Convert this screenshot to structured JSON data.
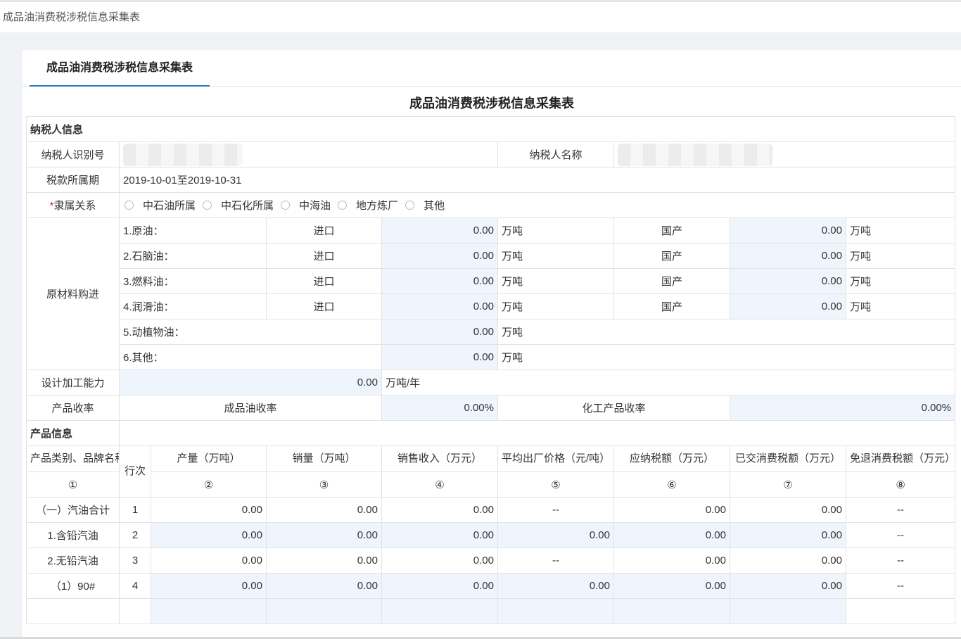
{
  "header": {
    "title": "成品油消费税涉税信息采集表"
  },
  "tab": {
    "label": "成品油消费税涉税信息采集表"
  },
  "form": {
    "title": "成品油消费税涉税信息采集表",
    "taxpayer_section": "纳税人信息",
    "taxpayer_id_label": "纳税人识别号",
    "taxpayer_name_label": "纳税人名称",
    "period_label": "税款所属期",
    "period_value": "2019-10-01至2019-10-31",
    "affiliation_required_mark": "*",
    "affiliation_label": "隶属关系",
    "affiliation_options": [
      "中石油所属",
      "中石化所属",
      "中海油",
      "地方炼厂",
      "其他"
    ],
    "raw_label": "原材料购进",
    "raw_rows": [
      {
        "name": "1.原油：",
        "import_label": "进口",
        "import_value": "0.00",
        "unit": "万吨",
        "domestic_label": "国产",
        "domestic_value": "0.00",
        "domestic_unit": "万吨"
      },
      {
        "name": "2.石脑油：",
        "import_label": "进口",
        "import_value": "0.00",
        "unit": "万吨",
        "domestic_label": "国产",
        "domestic_value": "0.00",
        "domestic_unit": "万吨"
      },
      {
        "name": "3.燃料油：",
        "import_label": "进口",
        "import_value": "0.00",
        "unit": "万吨",
        "domestic_label": "国产",
        "domestic_value": "0.00",
        "domestic_unit": "万吨"
      },
      {
        "name": "4.润滑油：",
        "import_label": "进口",
        "import_value": "0.00",
        "unit": "万吨",
        "domestic_label": "国产",
        "domestic_value": "0.00",
        "domestic_unit": "万吨"
      }
    ],
    "raw_extra": [
      {
        "name": "5.动植物油：",
        "value": "0.00",
        "unit": "万吨"
      },
      {
        "name": "6.其他：",
        "value": "0.00",
        "unit": "万吨"
      }
    ],
    "capacity_label": "设计加工能力",
    "capacity_value": "0.00",
    "capacity_unit": "万吨/年",
    "yield_label": "产品收率",
    "refined_yield_label": "成品油收率",
    "refined_yield_value": "0.00%",
    "chemical_yield_label": "化工产品收率",
    "chemical_yield_value": "0.00%",
    "product_section": "产品信息",
    "product_headers": {
      "category": "产品类别、品牌名称",
      "row_no": "行次",
      "output": "产量（万吨）",
      "sales": "销量（万吨）",
      "revenue": "销售收入（万元）",
      "avg_price": "平均出厂价格（元/吨）",
      "tax_payable": "应纳税额（万元）",
      "tax_paid": "已交消费税额（万元）",
      "tax_refund": "免退消费税额（万元）"
    },
    "product_col_numbers": [
      "①",
      "②",
      "③",
      "④",
      "⑤",
      "⑥",
      "⑦",
      "⑧"
    ],
    "product_rows": [
      {
        "name": "（一）汽油合计",
        "no": "1",
        "output": "0.00",
        "sales": "0.00",
        "revenue": "0.00",
        "price": "--",
        "payable": "0.00",
        "paid": "0.00",
        "refund": "--"
      },
      {
        "name": "1.含铅汽油",
        "no": "2",
        "output": "0.00",
        "sales": "0.00",
        "revenue": "0.00",
        "price": "0.00",
        "payable": "0.00",
        "paid": "0.00",
        "refund": "--"
      },
      {
        "name": "2.无铅汽油",
        "no": "3",
        "output": "0.00",
        "sales": "0.00",
        "revenue": "0.00",
        "price": "--",
        "payable": "0.00",
        "paid": "0.00",
        "refund": "--"
      },
      {
        "name": "（1）90#",
        "no": "4",
        "output": "0.00",
        "sales": "0.00",
        "revenue": "0.00",
        "price": "0.00",
        "payable": "0.00",
        "paid": "0.00",
        "refund": "--"
      }
    ]
  }
}
